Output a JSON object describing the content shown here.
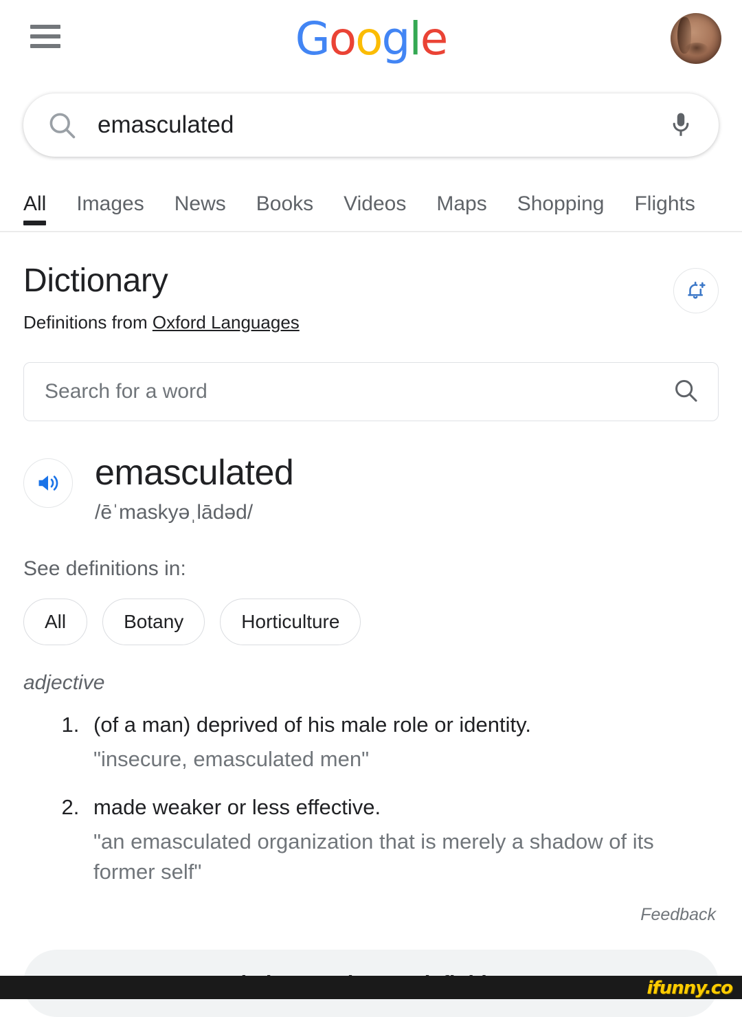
{
  "header": {
    "menu_icon": "hamburger-menu-icon",
    "logo_text": "Google",
    "logo_letters": [
      {
        "char": "G",
        "color": "#4285F4"
      },
      {
        "char": "o",
        "color": "#EA4335"
      },
      {
        "char": "o",
        "color": "#FBBC05"
      },
      {
        "char": "g",
        "color": "#4285F4"
      },
      {
        "char": "l",
        "color": "#34A853"
      },
      {
        "char": "e",
        "color": "#EA4335"
      }
    ],
    "avatar_label": "account-avatar"
  },
  "search": {
    "query": "emasculated",
    "search_icon": "search-icon",
    "mic_icon": "microphone-icon"
  },
  "tabs": [
    {
      "label": "All",
      "active": true
    },
    {
      "label": "Images",
      "active": false
    },
    {
      "label": "News",
      "active": false
    },
    {
      "label": "Books",
      "active": false
    },
    {
      "label": "Videos",
      "active": false
    },
    {
      "label": "Maps",
      "active": false
    },
    {
      "label": "Shopping",
      "active": false
    },
    {
      "label": "Flights",
      "active": false
    }
  ],
  "dictionary": {
    "title": "Dictionary",
    "source_prefix": "Definitions from ",
    "source_link": "Oxford Languages",
    "notify_icon": "add-alert-bell-icon",
    "notify_icon_color": "#3c78c8",
    "word_search_placeholder": "Search for a word",
    "word_search_icon": "search-icon",
    "headword": "emasculated",
    "phonetic": "/ēˈmaskyəˌlādəd/",
    "speaker_icon": "speaker-volume-icon",
    "speaker_icon_color": "#1a73e8",
    "see_definitions_label": "See definitions in:",
    "chips": [
      "All",
      "Botany",
      "Horticulture"
    ],
    "part_of_speech": "adjective",
    "definitions": [
      {
        "number": "1.",
        "text": "(of a man) deprived of his male role or identity.",
        "example": "\"insecure, emasculated men\""
      },
      {
        "number": "2.",
        "text": "made weaker or less effective.",
        "example": "\"an emasculated organization that is merely a shadow of its former self\""
      }
    ],
    "feedback_label": "Feedback",
    "more_button_label": "Translations and more definitions",
    "more_button_chevron": "chevron-down-icon"
  },
  "watermark": {
    "text": "ifunny.co",
    "color": "#ffcc00"
  }
}
